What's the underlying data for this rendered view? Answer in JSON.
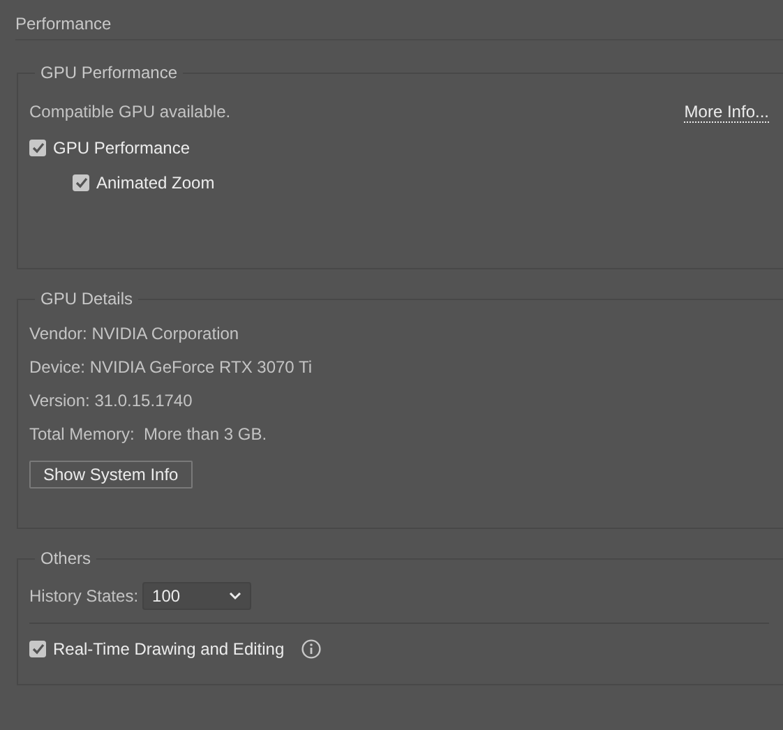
{
  "title": "Performance",
  "gpu_performance": {
    "title": "GPU Performance",
    "status": "Compatible GPU available.",
    "more_info_link": "More Info...",
    "options": [
      {
        "label": "GPU Performance",
        "checked": true,
        "children": [
          {
            "label": "Animated Zoom",
            "checked": true
          }
        ]
      }
    ]
  },
  "gpu_details": {
    "title": "GPU Details",
    "lines": [
      "Vendor: NVIDIA Corporation",
      "Device: NVIDIA GeForce RTX 3070 Ti",
      "Version: 31.0.15.1740",
      "Total Memory:  More than 3 GB."
    ],
    "button": "Show System Info"
  },
  "others": {
    "title": "Others",
    "history_states": {
      "label": "History States:",
      "value": "100"
    },
    "real_time": {
      "label": "Real-Time Drawing and Editing",
      "checked": true
    }
  }
}
